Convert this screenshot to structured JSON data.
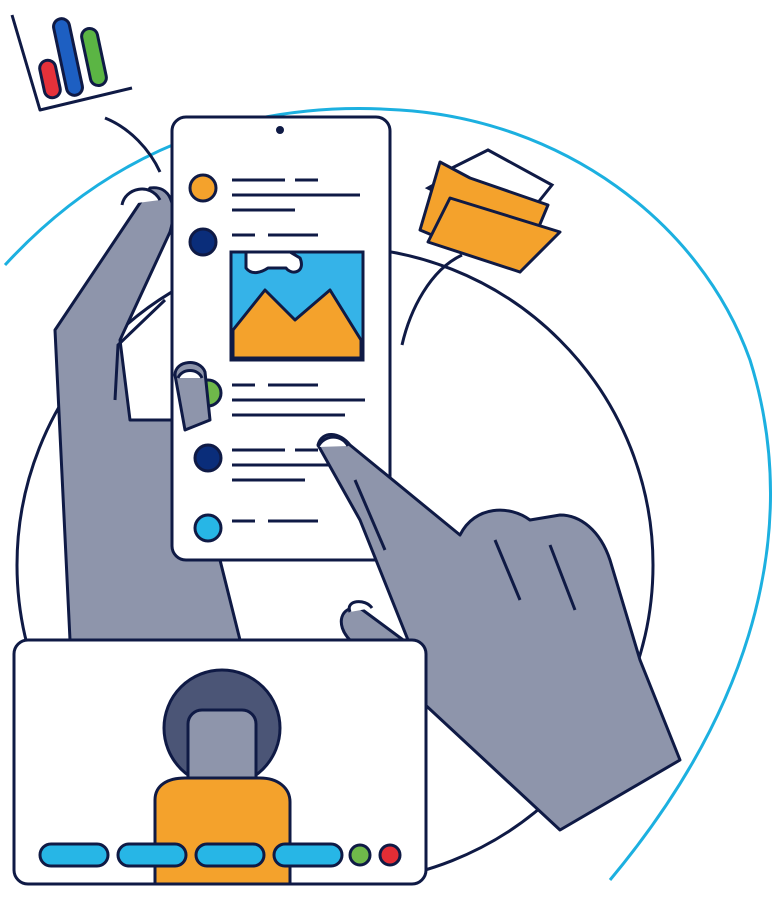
{
  "illustration": {
    "colors": {
      "outline": "#0f1a45",
      "hand": "#8e95ab",
      "hand_shadow": "#6b7390",
      "orange": "#f4a22c",
      "navy": "#0a2d7a",
      "green": "#6fb84a",
      "cyan": "#27b6e6",
      "red": "#e32d35",
      "accent_ring": "#1cb0e0",
      "screen_bg": "#ffffff",
      "sky": "#35b3e8",
      "face": "#8e95ab",
      "hair": "#4b5576",
      "chart_blue": "#1d5fc2",
      "chart_green": "#5bb544",
      "chart_red": "#e5313a"
    },
    "icons": [
      "bar-chart-icon",
      "folder-icon",
      "smartphone",
      "image-icon",
      "video-call-window",
      "user-avatar"
    ],
    "feed_bullets": [
      "orange",
      "navy",
      "green",
      "navy",
      "cyan"
    ],
    "call_controls": [
      "cyan",
      "cyan",
      "cyan",
      "cyan",
      "green",
      "red"
    ]
  }
}
